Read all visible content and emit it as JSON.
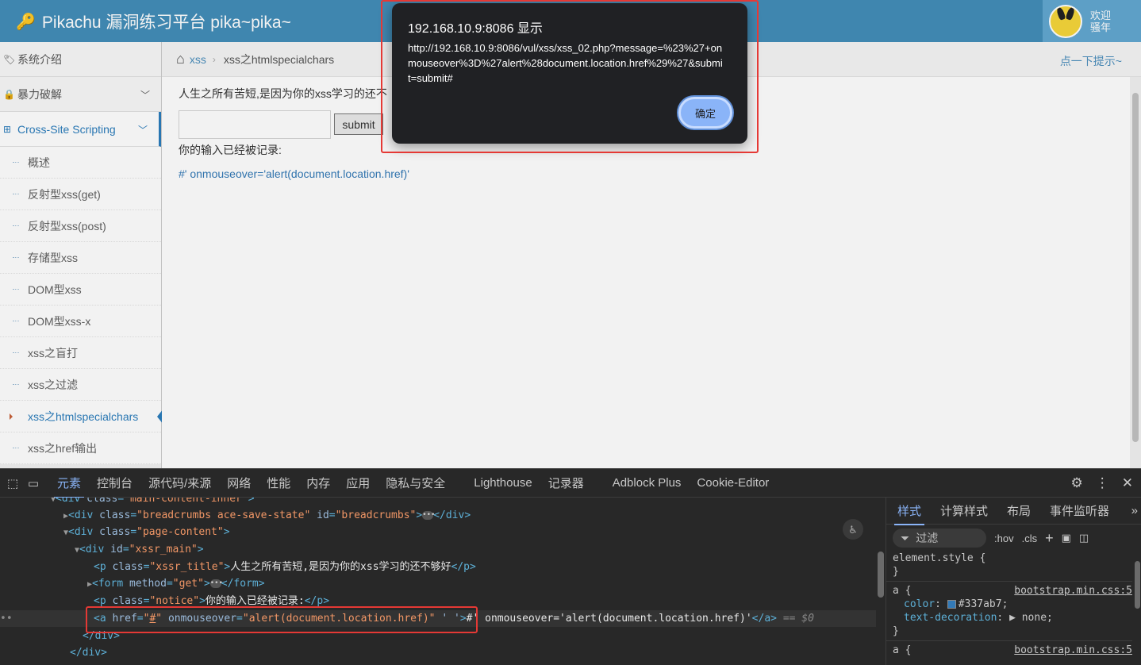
{
  "navbar": {
    "brand": "Pikachu 漏洞练习平台 pika~pika~",
    "user_line1": "欢迎",
    "user_line2": "骚年"
  },
  "sidebar": {
    "items": [
      {
        "label": "系统介绍",
        "icon": "tag-icon"
      },
      {
        "label": "暴力破解",
        "icon": "lock-icon"
      },
      {
        "label": "Cross-Site Scripting",
        "icon": "tree-icon"
      }
    ],
    "sub_items": [
      "概述",
      "反射型xss(get)",
      "反射型xss(post)",
      "存储型xss",
      "DOM型xss",
      "DOM型xss-x",
      "xss之盲打",
      "xss之过滤",
      "xss之htmlspecialchars",
      "xss之href输出"
    ],
    "active_sub": "xss之htmlspecialchars"
  },
  "breadcrumbs": {
    "link": "xss",
    "current": "xss之htmlspecialchars",
    "hint": "点一下提示~"
  },
  "main": {
    "title": "人生之所有苦短,是因为你的xss学习的还不",
    "input_value": "",
    "submit_label": "submit",
    "notice": "你的输入已经被记录:",
    "output_link": "#' onmouseover='alert(document.location.href)'"
  },
  "dialog": {
    "title": "192.168.10.9:8086 显示",
    "message": "http://192.168.10.9:8086/vul/xss/xss_02.php?message=%23%27+onmouseover%3D%27alert%28document.location.href%29%27&submit=submit#",
    "ok_label": "确定"
  },
  "devtools": {
    "tabs": [
      "元素",
      "控制台",
      "源代码/来源",
      "网络",
      "性能",
      "内存",
      "应用",
      "隐私与安全",
      "Lighthouse",
      "记录器",
      "Adblock Plus",
      "Cookie-Editor"
    ],
    "active_tab": "元素",
    "dom": {
      "line0": "<div class=\"main-content-inner\">",
      "line1_tag": "div",
      "line1_attrs": [
        [
          "class",
          "breadcrumbs ace-save-state"
        ],
        [
          "id",
          "breadcrumbs"
        ]
      ],
      "line2_attrs": [
        [
          "class",
          "page-content"
        ]
      ],
      "line3_attrs": [
        [
          "id",
          "xssr_main"
        ]
      ],
      "line4_class": "xssr_title",
      "line4_text": "人生之所有苦短,是因为你的xss学习的还不够好",
      "line5_method": "get",
      "line6_class": "notice",
      "line6_text": "你的输入已经被记录:",
      "line7_href": "#",
      "line7_onmouseover": "alert(document.location.href)",
      "line7_extra": "' '",
      "line7_text_prefix": "#'",
      "line7_text": " onmouseover='alert(document.location.href)'",
      "line7_marker": "== $0"
    },
    "styles": {
      "tabs": [
        "样式",
        "计算样式",
        "布局",
        "事件监听器"
      ],
      "active_tab": "样式",
      "filter_placeholder": "过滤",
      "hov": ":hov",
      "cls": ".cls",
      "element_style": "element.style {",
      "close_brace": "}",
      "rule1_selector": "a {",
      "rule1_source": "bootstrap.min.css:5",
      "rule1_color_prop": "color",
      "rule1_color_value": "#337ab7;",
      "rule1_td_prop": "text-decoration",
      "rule1_td_value": "none;",
      "rule2_selector": "a {",
      "rule2_source": "bootstrap.min.css:5"
    }
  },
  "colors": {
    "navbar": "#438eb9",
    "accent": "#2b7dbc",
    "link": "#337ab7",
    "highlight_box": "#e53935",
    "dialog_bg": "#202124",
    "devtools_bg": "#282828"
  }
}
